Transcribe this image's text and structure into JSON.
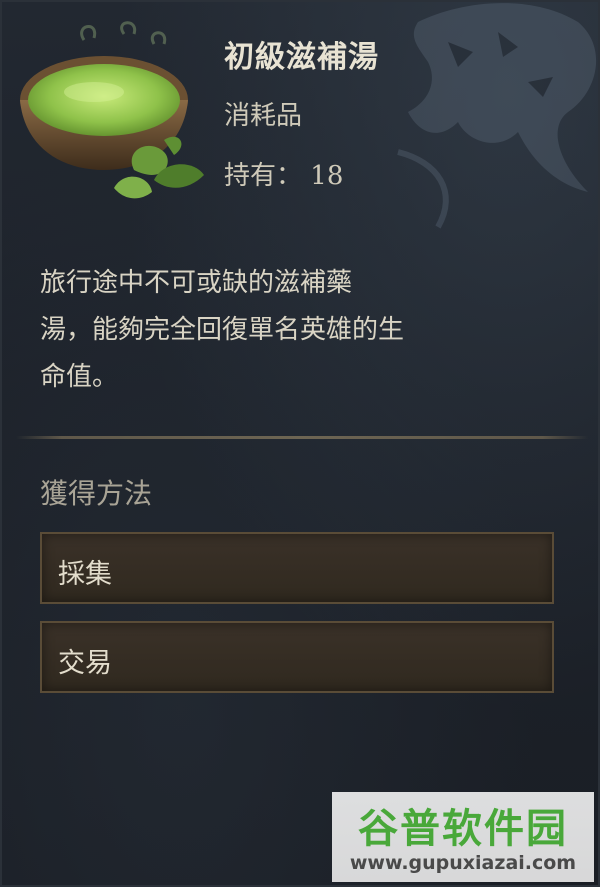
{
  "item": {
    "name": "初級滋補湯",
    "type": "消耗品",
    "owned_label": "持有：",
    "owned_count": "18",
    "icon": "herbal-soup-bowl-icon",
    "description_lines": [
      "旅行途中不可或缺的滋補藥",
      "湯，能夠完全回復單名英雄的生",
      "命值。"
    ]
  },
  "acquisition": {
    "title": "獲得方法",
    "methods": [
      "採集",
      "交易"
    ]
  },
  "watermark": {
    "title": "谷普软件园",
    "url": "www.gupuxiazai.com"
  },
  "colors": {
    "panel_bg": "#1c2129",
    "text_primary": "#e8e3d3",
    "method_border": "#5a4c37",
    "soup_green": "#8fc24a",
    "watermark_green": "#49a83a"
  }
}
